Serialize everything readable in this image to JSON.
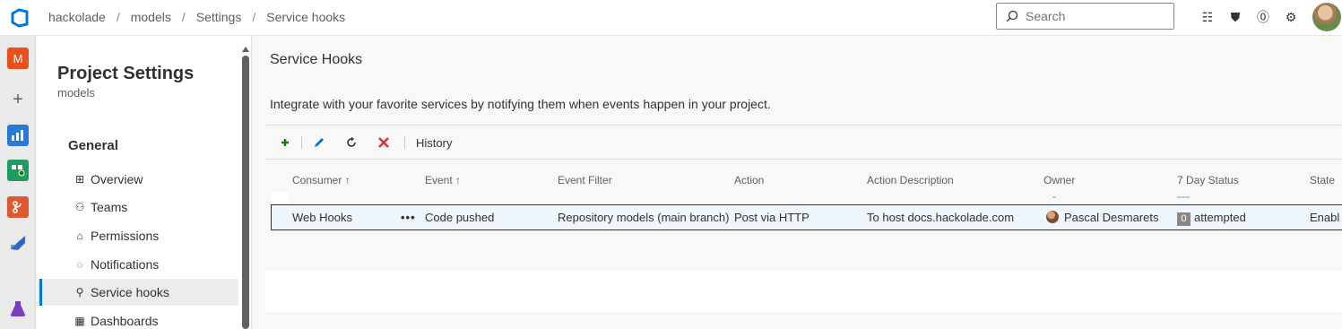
{
  "breadcrumb": {
    "org": "hackolade",
    "project": "models",
    "section": "Settings",
    "page": "Service hooks"
  },
  "search": {
    "placeholder": "Search"
  },
  "top_icons": [
    "task-list-icon",
    "shopping-bag-icon",
    "help-icon",
    "user-settings-icon"
  ],
  "rail": {
    "items": [
      {
        "icon": "project-m-icon",
        "label": "M",
        "color": "#e8501c"
      },
      {
        "icon": "plus-icon",
        "label": "+"
      },
      {
        "icon": "overview-icon",
        "color": "#2a7ad5"
      },
      {
        "icon": "boards-icon",
        "color": "#1e9b5e"
      },
      {
        "icon": "repos-icon",
        "color": "#e0582e"
      },
      {
        "icon": "pipelines-icon",
        "color": "#2b67c4"
      },
      {
        "icon": "test-plans-icon",
        "color": "#7b3fbd"
      }
    ]
  },
  "nav": {
    "title": "Project Settings",
    "subtitle": "models",
    "group": "General",
    "items": [
      {
        "label": "Overview",
        "icon": "⊞",
        "active": false
      },
      {
        "label": "Teams",
        "icon": "⚇",
        "active": false
      },
      {
        "label": "Permissions",
        "icon": "⌂",
        "active": false
      },
      {
        "label": "Notifications",
        "icon": "◌",
        "active": false
      },
      {
        "label": "Service hooks",
        "icon": "⚲",
        "active": true
      },
      {
        "label": "Dashboards",
        "icon": "▦",
        "active": false
      }
    ]
  },
  "main": {
    "title": "Service Hooks",
    "description": "Integrate with your favorite services by notifying them when events happen in your project.",
    "toolbar": {
      "history_label": "History"
    },
    "columns": {
      "consumer": "Consumer ↑",
      "event": "Event ↑",
      "event_filter": "Event Filter",
      "action": "Action",
      "action_description": "Action Description",
      "owner": "Owner",
      "status": "7 Day Status",
      "state": "State"
    },
    "rows": [
      {
        "consumer": "Web Hooks",
        "more": "•••",
        "event": "Code pushed",
        "event_filter": "Repository models (main branch)",
        "action": "Post via HTTP",
        "action_description": "To host docs.hackolade.com",
        "owner": "Pascal Desmarets",
        "status_count": "0",
        "status_text": "attempted",
        "state": "Enabl"
      }
    ]
  },
  "colors": {
    "accent": "#0078d4",
    "add_green": "#107c10",
    "delete_red": "#d13438",
    "row_selected": "#eff6fc"
  }
}
